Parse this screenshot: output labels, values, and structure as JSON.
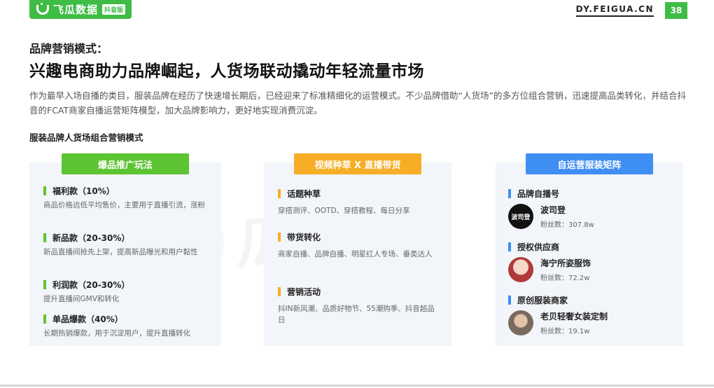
{
  "header": {
    "logo_text": "飞瓜数据",
    "logo_tag": "抖音版",
    "site_url": "DY.FEIGUA.CN",
    "page_number": "38",
    "brand_color": "#3fbc45"
  },
  "content": {
    "kicker": "品牌营销模式：",
    "headline": "兴趣电商助力品牌崛起，人货场联动撬动年轻流量市场",
    "intro": "作为最早入场自播的类目，服装品牌在经历了快速增长期后，已经迎来了标准精细化的运营模式。不少品牌借助“人货场”的多方位组合营销，迅速提高品类转化，并结合抖音的FCAT商家自播运营矩阵模型，加大品牌影响力，更好地实现消费沉淀。",
    "section_label": "服装品牌人货场组合营销模式",
    "watermark": "飞瓜数据"
  },
  "columns": [
    {
      "title": "爆品推广玩法",
      "color": "#5cc432",
      "items": [
        {
          "title": "福利款（10%）",
          "desc": "商品价格远低平均售价，主要用于直播引流，涨粉"
        },
        {
          "title": "新品款（20-30%）",
          "desc": "新品直播间抢先上架，提高新品曝光和用户黏性"
        },
        {
          "title": "利润款（20-30%）",
          "desc": "提升直播间GMV和转化"
        },
        {
          "title": "单品爆款（40%）",
          "desc": "长期热销爆款，用于沉淀用户，提升直播转化"
        }
      ]
    },
    {
      "title": "视频种草 X 直播带货",
      "color": "#f7ad26",
      "items": [
        {
          "title": "话题种草",
          "desc": "穿搭测评、OOTD、穿搭教程、每日分享"
        },
        {
          "title": "带货转化",
          "desc": "商家自播、品牌自播、明星红人专场、垂类达人"
        },
        {
          "title": "营销活动",
          "desc": "抖IN新风潮、品质好物节、55潮购季、抖音超品日"
        }
      ]
    },
    {
      "title": "自运营服装矩阵",
      "color": "#3f8ef4",
      "groups": [
        {
          "title": "品牌自播号",
          "brand": "波司登",
          "fans": "粉丝数：307.8w",
          "avatar_text": "波司登"
        },
        {
          "title": "授权供应商",
          "brand": "海宁所姿服饰",
          "fans": "粉丝数：72.2w",
          "avatar_text": ""
        },
        {
          "title": "原创服装商家",
          "brand": "老贝轻奢女装定制",
          "fans": "粉丝数：19.1w",
          "avatar_text": ""
        }
      ]
    }
  ]
}
